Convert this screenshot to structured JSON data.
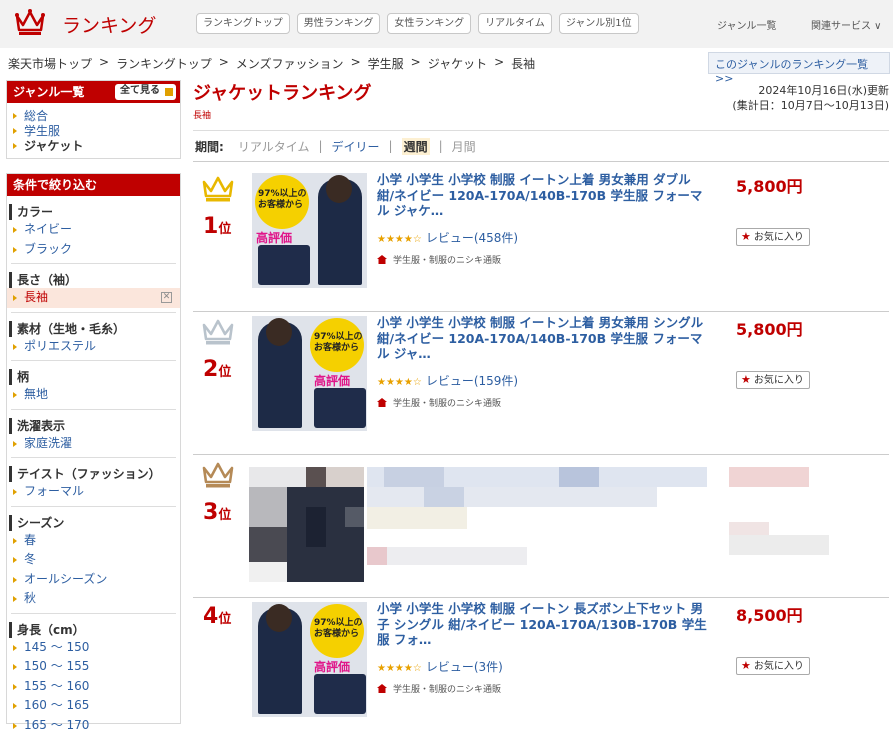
{
  "header": {
    "logo_text": "ランキング",
    "tabs": [
      "ランキングトップ",
      "男性ランキング",
      "女性ランキング",
      "リアルタイム",
      "ジャンル別1位"
    ],
    "right_links": [
      "ジャンル一覧",
      "関連サービス ∨"
    ]
  },
  "breadcrumb": [
    "楽天市場トップ",
    "ランキングトップ",
    "メンズファッション",
    "学生服",
    "ジャケット",
    "長袖"
  ],
  "breadcrumb_sep": ">",
  "genre_ranking_link": "このジャンルのランキング一覧 >>",
  "sidebar": {
    "genre_title": "ジャンル一覧",
    "show_all": "全て見る",
    "genres": [
      "総合",
      "学生服",
      "ジャケット"
    ],
    "filter_title": "条件で絞り込む",
    "filters": [
      {
        "title": "カラー",
        "items": [
          "ネイビー",
          "ブラック"
        ]
      },
      {
        "title": "長さ（袖）",
        "items": [
          "長袖"
        ],
        "selected": 0
      },
      {
        "title": "素材（生地・毛糸）",
        "items": [
          "ポリエステル"
        ]
      },
      {
        "title": "柄",
        "items": [
          "無地"
        ]
      },
      {
        "title": "洗濯表示",
        "items": [
          "家庭洗濯"
        ]
      },
      {
        "title": "テイスト（ファッション）",
        "items": [
          "フォーマル"
        ]
      },
      {
        "title": "シーズン",
        "items": [
          "春",
          "冬",
          "オールシーズン",
          "秋"
        ]
      },
      {
        "title": "身長（cm）",
        "items": [
          "145 ～ 150",
          "150 ～ 155",
          "155 ～ 160",
          "160 ～ 165",
          "165 ～ 170"
        ]
      }
    ]
  },
  "main": {
    "title": "ジャケットランキング",
    "subtitle": "長袖",
    "updated_line1": "2024年10月16日(水)更新",
    "updated_line2": "(集計日：10月7日～10月13日)",
    "period_label": "期間:",
    "periods": [
      "リアルタイム",
      "デイリー",
      "週間",
      "月間"
    ],
    "active_period": "週間"
  },
  "items": [
    {
      "rank": "1",
      "rank_suffix": "位",
      "crown": "gold",
      "title": "小学 小学生 小学校 制服 イートン上着 男女兼用 ダブル 紺/ネイビー 120A-170A/140B-170B 学生服 フォーマル ジャケ…",
      "stars": "★★★★☆",
      "review": "レビュー(458件)",
      "shop": "学生服・制服のニシキ通販",
      "price": "5,800円",
      "fav": "お気に入り",
      "thumb_badge": "97%以上の\nお客様から",
      "thumb_rate": "高評価"
    },
    {
      "rank": "2",
      "rank_suffix": "位",
      "crown": "silver",
      "title": "小学 小学生 小学校 制服 イートン上着 男女兼用 シングル 紺/ネイビー 120A-170A/140B-170B 学生服 フォーマル ジャ…",
      "stars": "★★★★☆",
      "review": "レビュー(159件)",
      "shop": "学生服・制服のニシキ通販",
      "price": "5,800円",
      "fav": "お気に入り",
      "thumb_badge": "97%以上の\nお客様から",
      "thumb_rate": "高評価"
    },
    {
      "rank": "3",
      "rank_suffix": "位",
      "crown": "bronze"
    },
    {
      "rank": "4",
      "rank_suffix": "位",
      "crown": "none",
      "title": "小学 小学生 小学校 制服 イートン 長ズボン上下セット 男子 シングル 紺/ネイビー 120A-170A/130B-170B 学生服 フォ…",
      "stars": "★★★★☆",
      "review": "レビュー(3件)",
      "shop": "学生服・制服のニシキ通販",
      "price": "8,500円",
      "fav": "お気に入り",
      "thumb_badge": "97%以上の\nお客様から",
      "thumb_rate": "高評価"
    }
  ],
  "colors": {
    "brand": "#bf0000",
    "link": "#2d5ea1",
    "gold": "#e8b800",
    "silver": "#b9c3cc",
    "bronze": "#b58a57"
  }
}
